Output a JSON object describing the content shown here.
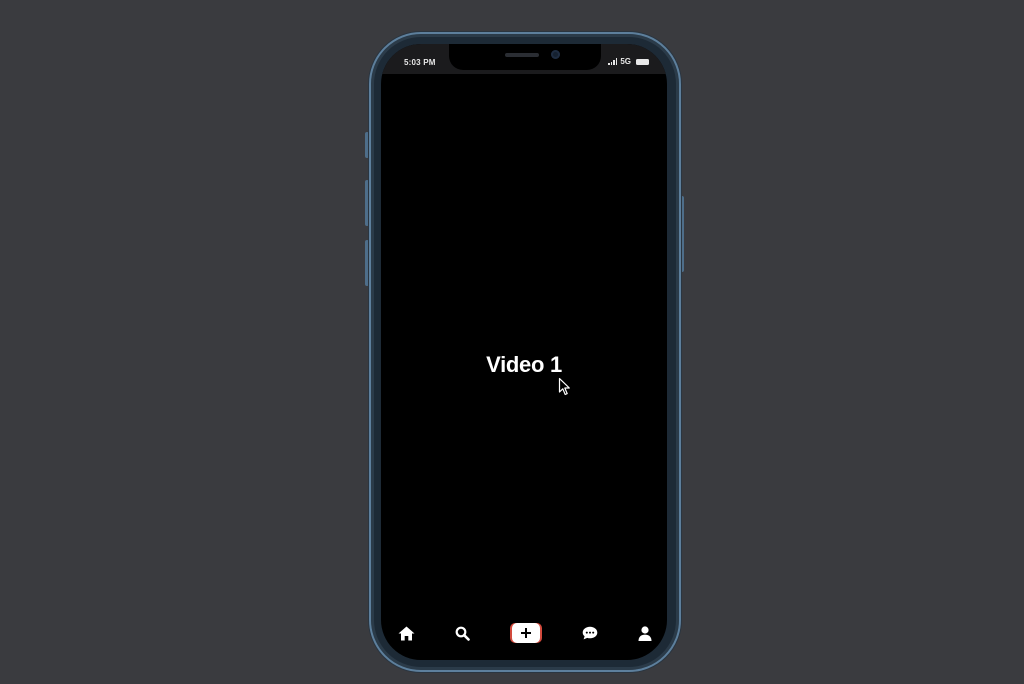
{
  "status_bar": {
    "time": "5:03 PM",
    "network": "5G",
    "signal_icon": "cellular-signal-icon",
    "battery_icon": "battery-icon"
  },
  "video": {
    "title": "Video 1"
  },
  "tab_bar": {
    "items": [
      {
        "name": "home",
        "icon": "home-icon"
      },
      {
        "name": "search",
        "icon": "search-icon"
      },
      {
        "name": "create",
        "icon": "plus-icon"
      },
      {
        "name": "messages",
        "icon": "chat-bubble-icon"
      },
      {
        "name": "profile",
        "icon": "person-icon"
      }
    ]
  },
  "colors": {
    "background": "#3a3b3f",
    "screen": "#000000",
    "frame": "#5d7f9c",
    "create_accent": "#d24a3d"
  }
}
